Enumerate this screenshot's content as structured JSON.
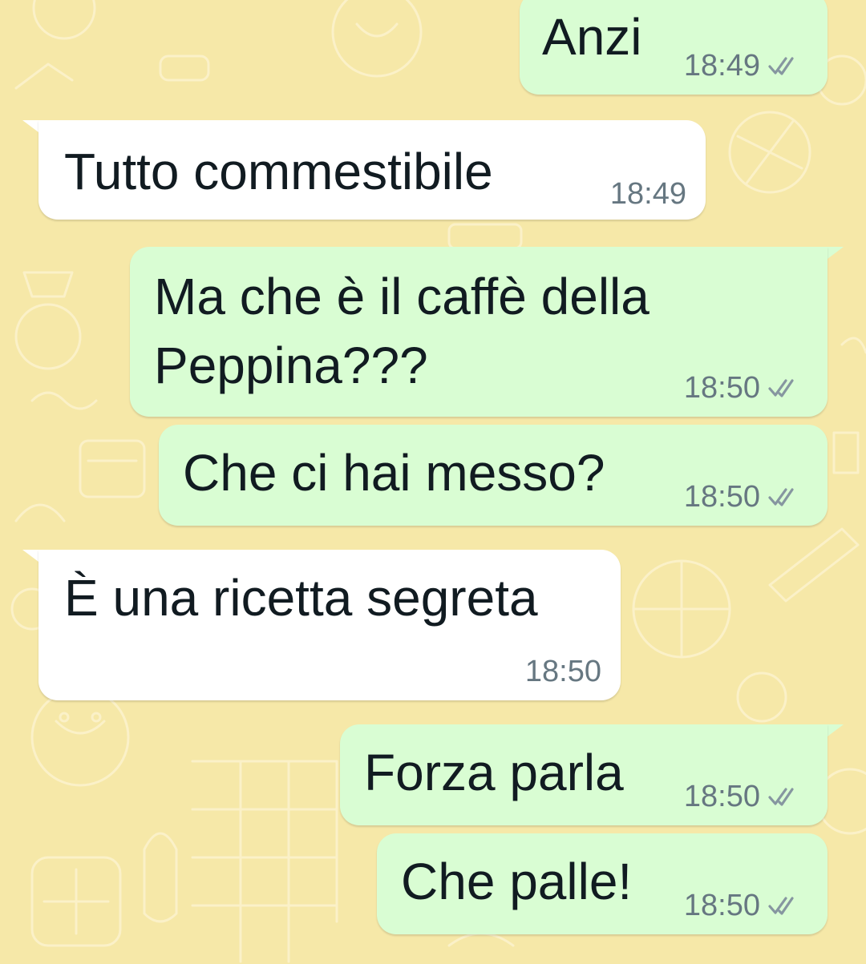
{
  "messages": [
    {
      "direction": "outgoing",
      "text": "Anzi",
      "time": "18:49",
      "status_icon": "double-check-icon"
    },
    {
      "direction": "incoming",
      "text": "Tutto commestibile",
      "time": "18:49"
    },
    {
      "direction": "outgoing",
      "lines": [
        "Ma che è il caffè della",
        "Peppina???"
      ],
      "time": "18:50",
      "status_icon": "double-check-icon"
    },
    {
      "direction": "outgoing",
      "text": "Che ci hai messo?",
      "time": "18:50",
      "status_icon": "double-check-icon"
    },
    {
      "direction": "incoming",
      "text": "È una ricetta segreta",
      "time": "18:50"
    },
    {
      "direction": "outgoing",
      "text": "Forza parla",
      "time": "18:50",
      "status_icon": "double-check-icon"
    },
    {
      "direction": "outgoing",
      "text": "Che palle!",
      "time": "18:50",
      "status_icon": "double-check-icon"
    }
  ],
  "colors": {
    "wallpaper": "#f6e8a8",
    "outgoing_bubble": "#d9fdd3",
    "incoming_bubble": "#ffffff",
    "text": "#111b21",
    "meta": "#667781"
  }
}
